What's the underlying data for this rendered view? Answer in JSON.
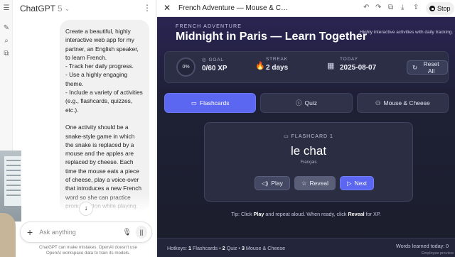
{
  "chat": {
    "model_name": "ChatGPT",
    "model_version": "5",
    "user_message": "Create a beautiful, highly interactive web app for my partner, an English speaker, to learn French.\n- Track her daily progress.\n- Use a highly engaging theme.\n- Include a variety of activities (e.g., flashcards, quizzes, etc.).\n\nOne activity should be a snake-style game in which the snake is replaced by a mouse and the apples are replaced by cheese. Each time the mouse eats a piece of cheese, play a voice-over that introduces a new French word so she can practice pronunciation while playing. Make it controllable with the arrow keys.",
    "composer_placeholder": "Ask anything",
    "disclaimer": "ChatGPT can make mistakes. OpenAI doesn't use OpenAI workspace data to train its models."
  },
  "canvas": {
    "title": "French Adventure — Mouse & C…",
    "stop_label": "Stop"
  },
  "app": {
    "eyebrow": "FRENCH ADVENTURE",
    "title": "Midnight in Paris — Learn Together",
    "tagline": "Highly interactive activities with daily tracking.",
    "progress_percent": "0%",
    "stats": {
      "goal_label": "GOAL",
      "goal_value": "0/60 XP",
      "streak_label": "STREAK",
      "streak_value": "2 days",
      "today_label": "TODAY",
      "today_value": "2025-08-07"
    },
    "reset_label": "Reset All",
    "tabs": [
      {
        "label": "Flashcards",
        "icon": "book-icon"
      },
      {
        "label": "Quiz",
        "icon": "question-icon"
      },
      {
        "label": "Mouse & Cheese",
        "icon": "mouse-icon"
      }
    ],
    "flashcard": {
      "kicker": "FLASHCARD 1",
      "word": "le chat",
      "language": "Français",
      "play_label": "Play",
      "reveal_label": "Reveal",
      "next_label": "Next"
    },
    "tip": {
      "prefix": "Tip: Click ",
      "play": "Play",
      "middle": " and repeat aloud. When ready, click ",
      "reveal": "Reveal",
      "suffix": " for XP."
    },
    "footer": {
      "hotkeys_prefix": "Hotkeys: ",
      "k1": "1",
      "t1": " Flashcards • ",
      "k2": "2",
      "t2": " Quiz • ",
      "k3": "3",
      "t3": " Mouse & Cheese",
      "learned": "Words learned today: 0",
      "employee_preview": "Employee preview"
    }
  }
}
